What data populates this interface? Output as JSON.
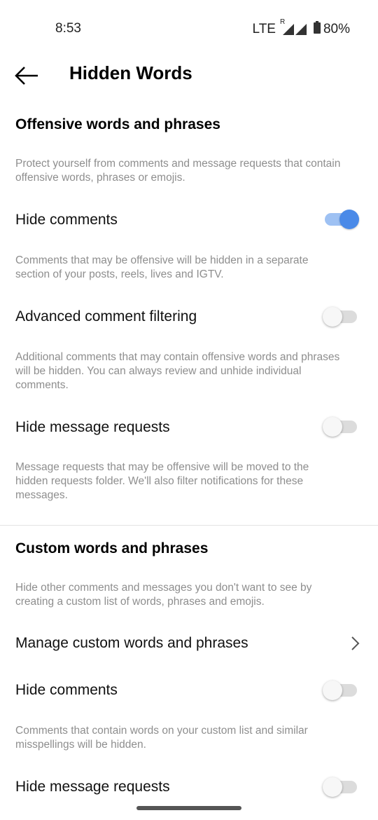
{
  "status_bar": {
    "time": "8:53",
    "network": "LTE",
    "roaming": "R",
    "battery": "80%"
  },
  "header": {
    "title": "Hidden Words"
  },
  "offensive": {
    "heading": "Offensive words and phrases",
    "description": "Protect yourself from comments and message requests that contain offensive words, phrases or emojis.",
    "hide_comments": {
      "label": "Hide comments",
      "on": true,
      "desc": "Comments that may be offensive will be hidden in a separate section of your posts, reels, lives and IGTV."
    },
    "advanced": {
      "label": "Advanced comment filtering",
      "on": false,
      "desc": "Additional comments that may contain offensive words and phrases will be hidden. You can always review and unhide individual comments."
    },
    "hide_messages": {
      "label": "Hide message requests",
      "on": false,
      "desc": "Message requests that may be offensive will be moved to the hidden requests folder. We'll also filter notifications for these messages."
    }
  },
  "custom": {
    "heading": "Custom words and phrases",
    "description": "Hide other comments and messages you don't want to see by creating a custom list of words, phrases and emojis.",
    "manage_label": "Manage custom words and phrases",
    "hide_comments": {
      "label": "Hide comments",
      "on": false,
      "desc": "Comments that contain words on your custom list and similar misspellings will be hidden."
    },
    "hide_messages": {
      "label": "Hide message requests",
      "on": false
    }
  },
  "colors": {
    "accent": "#4a8ae8",
    "accent_track": "#9ec1f3",
    "muted_text": "#8e8e8e"
  }
}
